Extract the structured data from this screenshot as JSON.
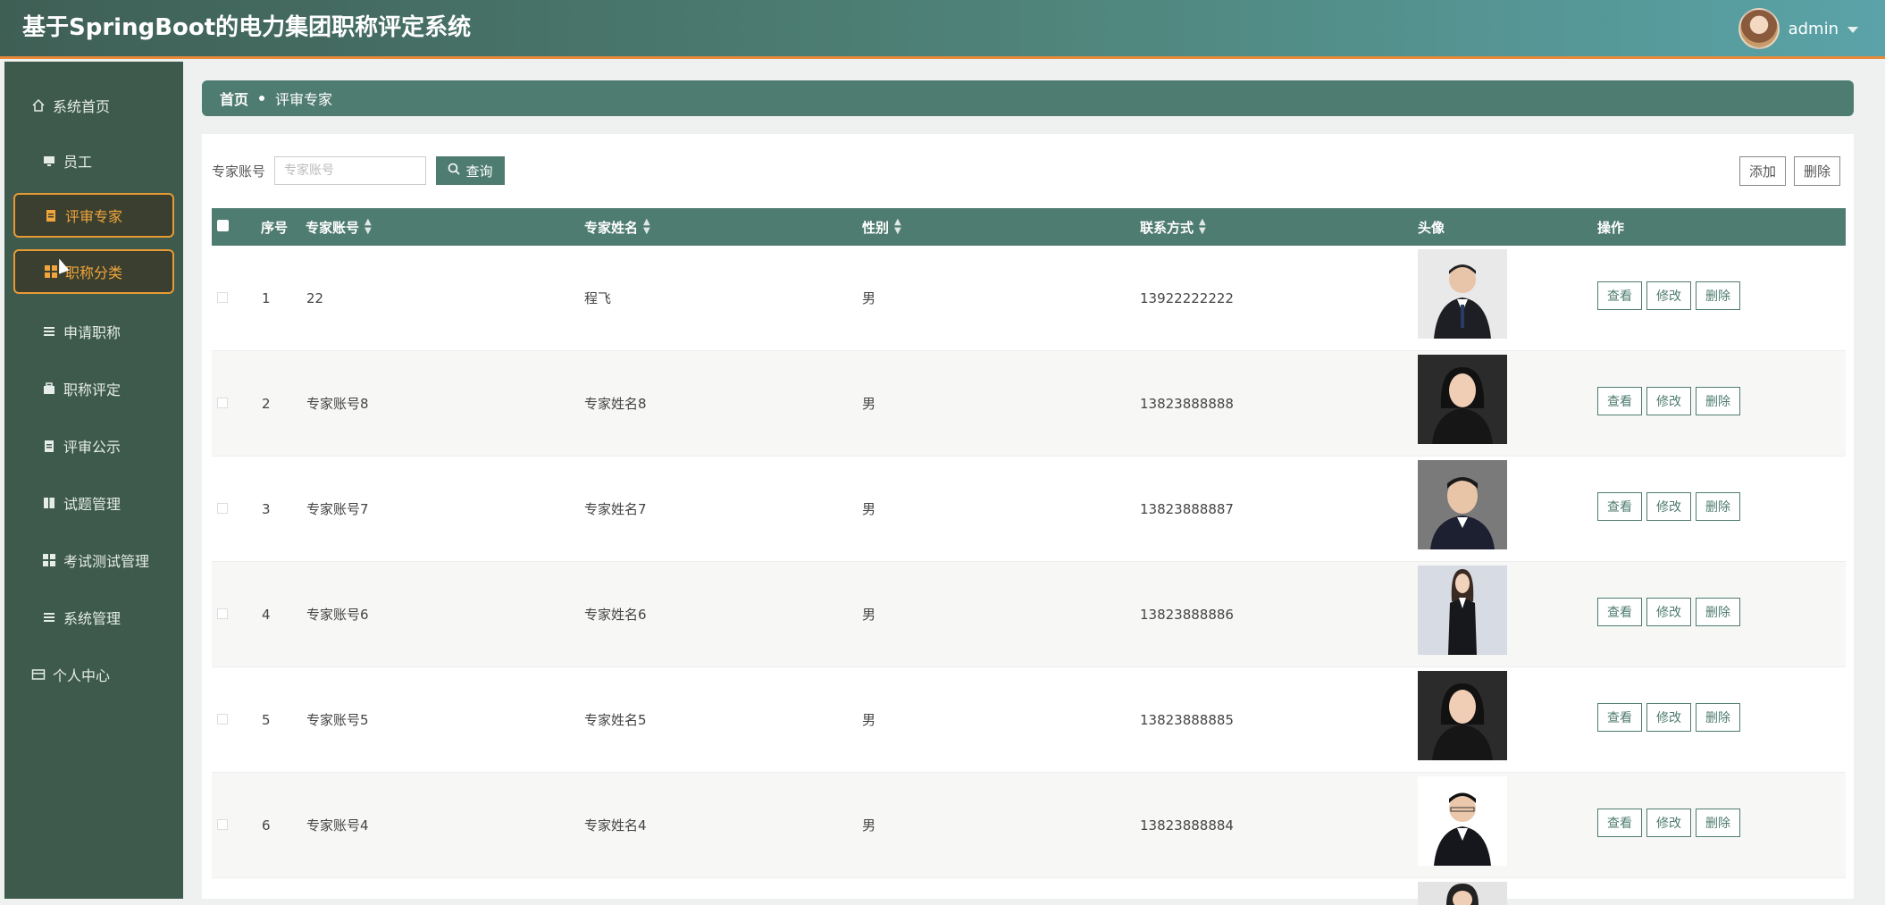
{
  "app": {
    "title": "基于SpringBoot的电力集团职称评定系统"
  },
  "user": {
    "name": "admin"
  },
  "sidebar": {
    "items": [
      {
        "label": "系统首页",
        "icon": "home-icon"
      },
      {
        "label": "员工",
        "icon": "monitor-icon"
      },
      {
        "label": "评审专家",
        "icon": "clipboard-icon",
        "active": true
      },
      {
        "label": "职称分类",
        "icon": "grid-icon",
        "highlighted": true
      },
      {
        "label": "申请职称",
        "icon": "list-icon"
      },
      {
        "label": "职称评定",
        "icon": "briefcase-icon"
      },
      {
        "label": "评审公示",
        "icon": "clipboard-icon"
      },
      {
        "label": "试题管理",
        "icon": "book-icon"
      },
      {
        "label": "考试测试管理",
        "icon": "grid-icon"
      },
      {
        "label": "系统管理",
        "icon": "list-icon"
      },
      {
        "label": "个人中心",
        "icon": "card-icon"
      }
    ]
  },
  "breadcrumb": {
    "home": "首页",
    "current": "评审专家"
  },
  "search": {
    "label": "专家账号",
    "placeholder": "专家账号",
    "button": "查询"
  },
  "toolbar": {
    "add": "添加",
    "delete": "删除"
  },
  "table": {
    "headers": {
      "index": "序号",
      "account": "专家账号",
      "name": "专家姓名",
      "gender": "性别",
      "phone": "联系方式",
      "avatar": "头像",
      "actions": "操作"
    },
    "actions": {
      "view": "查看",
      "edit": "修改",
      "delete": "删除"
    },
    "rows": [
      {
        "index": "1",
        "account": "22",
        "name": "程飞",
        "gender": "男",
        "phone": "13922222222"
      },
      {
        "index": "2",
        "account": "专家账号8",
        "name": "专家姓名8",
        "gender": "男",
        "phone": "13823888888"
      },
      {
        "index": "3",
        "account": "专家账号7",
        "name": "专家姓名7",
        "gender": "男",
        "phone": "13823888887"
      },
      {
        "index": "4",
        "account": "专家账号6",
        "name": "专家姓名6",
        "gender": "男",
        "phone": "13823888886"
      },
      {
        "index": "5",
        "account": "专家账号5",
        "name": "专家姓名5",
        "gender": "男",
        "phone": "13823888885"
      },
      {
        "index": "6",
        "account": "专家账号4",
        "name": "专家姓名4",
        "gender": "男",
        "phone": "13823888884"
      }
    ]
  },
  "colors": {
    "primary": "#4f7c70",
    "sidebar": "#3d5a4c",
    "accent": "#e89a35"
  }
}
